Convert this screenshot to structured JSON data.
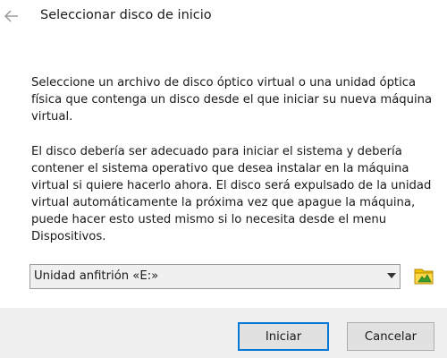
{
  "dialog": {
    "title": "Seleccionar disco de inicio",
    "back_icon": "back-arrow-icon",
    "paragraph1": "Seleccione un archivo de disco óptico virtual o una unidad óptica física que contenga un disco desde el que iniciar su nueva máquina virtual.",
    "paragraph2": "El disco debería ser adecuado para iniciar el sistema y debería contener el sistema operativo que desea instalar en la máquina virtual si quiere hacerlo ahora. El disco será expulsado de la unidad virtual automáticamente la próxima vez que apague la máquina, puede hacer esto usted mismo si lo necesita desde el menu Dispositivos."
  },
  "disk_select": {
    "selected": "Unidad anfitrión «E:»",
    "arrow_icon": "chevron-down-icon",
    "folder_icon": "folder-icon"
  },
  "buttons": {
    "start_label": "Iniciar",
    "cancel_label": "Cancelar"
  },
  "colors": {
    "background": "#ffffff",
    "footer": "#f0f0f0",
    "focus_border": "#0078d7",
    "folder_yellow": "#f4c400",
    "folder_green": "#3a9a2c"
  }
}
